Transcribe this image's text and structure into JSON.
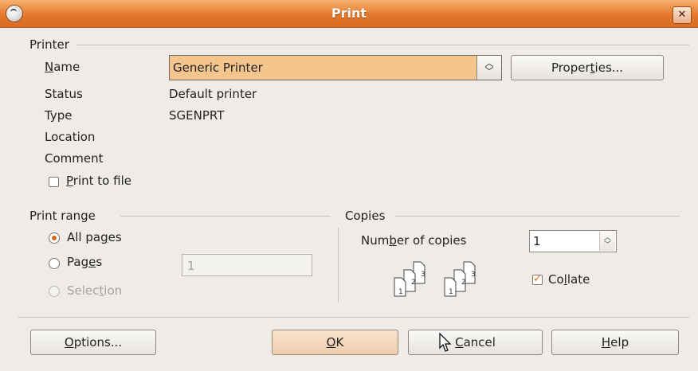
{
  "window": {
    "title": "Print"
  },
  "printer": {
    "section_title": "Printer",
    "name_label": "Name",
    "name_value": "Generic Printer",
    "properties_button": "Properties...",
    "status_label": "Status",
    "status_value": "Default printer",
    "type_label": "Type",
    "type_value": "SGENPRT",
    "location_label": "Location",
    "location_value": "",
    "comment_label": "Comment",
    "comment_value": "",
    "print_to_file_label": "Print to file",
    "print_to_file_checked": false
  },
  "print_range": {
    "section_title": "Print range",
    "all_pages_label": "All pages",
    "pages_label": "Pages",
    "pages_value": "1",
    "selection_label": "Selection",
    "selected": "All pages"
  },
  "copies": {
    "section_title": "Copies",
    "number_label": "Number of copies",
    "number_value": "1",
    "collate_label": "Collate",
    "collate_checked": true,
    "stack_labels": [
      "1",
      "2",
      "3"
    ]
  },
  "buttons": {
    "options": "Options...",
    "ok": "OK",
    "cancel": "Cancel",
    "help": "Help"
  },
  "colors": {
    "titlebar": "#e3782d",
    "highlight": "#f5c58e",
    "radio_dot": "#d8671b"
  }
}
